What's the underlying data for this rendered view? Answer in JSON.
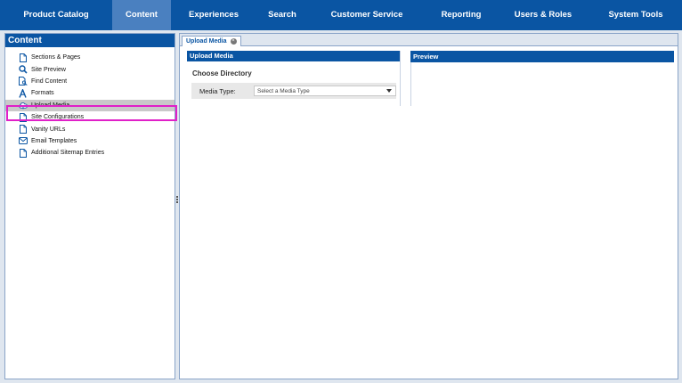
{
  "topnav": {
    "items": [
      {
        "label": "Product Catalog",
        "active": false
      },
      {
        "label": "Content",
        "active": true
      },
      {
        "label": "Experiences",
        "active": false
      },
      {
        "label": "Search",
        "active": false
      },
      {
        "label": "Customer Service",
        "active": false
      },
      {
        "label": "Reporting",
        "active": false
      },
      {
        "label": "Users & Roles",
        "active": false
      },
      {
        "label": "System Tools",
        "active": false
      }
    ]
  },
  "sidebar": {
    "title": "Content",
    "items": [
      {
        "label": "Sections & Pages",
        "icon": "page-icon"
      },
      {
        "label": "Site Preview",
        "icon": "magnifier-icon"
      },
      {
        "label": "Find Content",
        "icon": "page-search-icon"
      },
      {
        "label": "Formats",
        "icon": "font-format-icon"
      },
      {
        "label": "Upload Media",
        "icon": "cloud-upload-icon",
        "selected": true
      },
      {
        "label": "Site Configurations",
        "icon": "page-icon"
      },
      {
        "label": "Vanity URLs",
        "icon": "page-icon"
      },
      {
        "label": "Email Templates",
        "icon": "envelope-icon"
      },
      {
        "label": "Additional Sitemap Entries",
        "icon": "page-icon"
      }
    ]
  },
  "tabs": [
    {
      "label": "Upload Media",
      "close": "×"
    }
  ],
  "upload": {
    "header": "Upload Media",
    "section_title": "Choose Directory",
    "media_type_label": "Media Type:",
    "media_type_placeholder": "Select a Media Type"
  },
  "preview": {
    "header": "Preview"
  },
  "colors": {
    "brand_blue": "#0a55a3",
    "active_tab": "#4a80c0",
    "selection_highlight": "#e020c8"
  }
}
